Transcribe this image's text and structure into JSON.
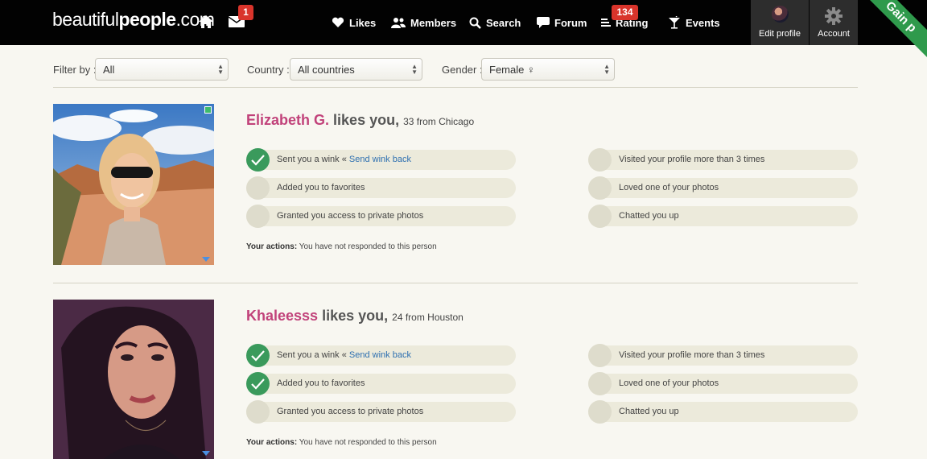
{
  "header": {
    "logo_regular_1": "beautiful",
    "logo_bold": "people",
    "logo_regular_2": ".com",
    "mail_count": "1",
    "rating_count": "134",
    "nav": [
      {
        "label": "Likes",
        "icon": "heart-icon"
      },
      {
        "label": "Members",
        "icon": "members-icon"
      },
      {
        "label": "Search",
        "icon": "search-icon"
      },
      {
        "label": "Forum",
        "icon": "chat-bubble-icon"
      },
      {
        "label": "Rating",
        "icon": "rating-list-icon"
      },
      {
        "label": "Events",
        "icon": "cocktail-icon"
      }
    ],
    "edit_profile": "Edit profile",
    "account": "Account",
    "ribbon": "Gain p"
  },
  "filters": {
    "filter_label": "Filter by :",
    "filter_value": "All",
    "country_label": "Country :",
    "country_value": "All countries",
    "gender_label": "Gender :",
    "gender_value": "Female ♀"
  },
  "profiles": [
    {
      "name": "Elizabeth G.",
      "likes_text": "likes you,",
      "meta": "33 from Chicago",
      "left_items": [
        {
          "text": "Sent you a wink «",
          "link": "Send wink back",
          "checked": true
        },
        {
          "text": "Added you to favorites",
          "checked": false
        },
        {
          "text": "Granted you access to private photos",
          "checked": false
        }
      ],
      "right_items": [
        {
          "text": "Visited your profile more than 3 times",
          "checked": false
        },
        {
          "text": "Loved one of your photos",
          "checked": false
        },
        {
          "text": "Chatted you up",
          "checked": false
        }
      ],
      "actions_label": "Your actions:",
      "actions_text": "You have not responded to this person"
    },
    {
      "name": "Khaleesss",
      "likes_text": "likes you,",
      "meta": "24 from Houston",
      "left_items": [
        {
          "text": "Sent you a wink «",
          "link": "Send wink back",
          "checked": true
        },
        {
          "text": "Added you to favorites",
          "checked": true
        },
        {
          "text": "Granted you access to private photos",
          "checked": false
        }
      ],
      "right_items": [
        {
          "text": "Visited your profile more than 3 times",
          "checked": false
        },
        {
          "text": "Loved one of your photos",
          "checked": false
        },
        {
          "text": "Chatted you up",
          "checked": false
        }
      ],
      "actions_label": "Your actions:",
      "actions_text": "You have not responded to this person"
    }
  ]
}
